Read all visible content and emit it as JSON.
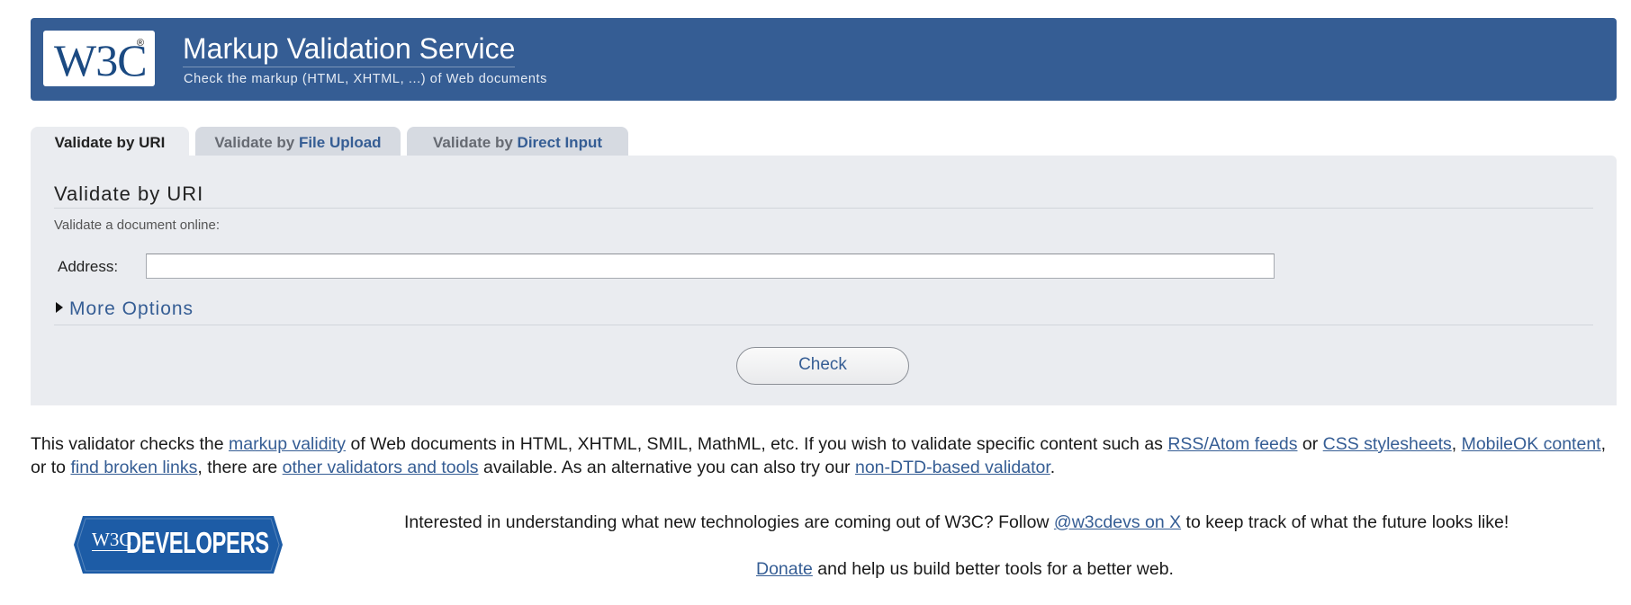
{
  "header": {
    "logo_text": "W3C",
    "logo_reg": "®",
    "title": "Markup Validation Service",
    "subtitle": "Check the markup (HTML, XHTML, ...) of Web documents"
  },
  "tabs": [
    {
      "prefix": "Validate by ",
      "highlight": "URI",
      "active": true
    },
    {
      "prefix": "Validate by ",
      "highlight": "File Upload",
      "active": false
    },
    {
      "prefix": "Validate by ",
      "highlight": "Direct Input",
      "active": false
    }
  ],
  "panel": {
    "heading": "Validate by URI",
    "description": "Validate a document online:",
    "address_label": "Address:",
    "address_value": "",
    "more_options_label": "More Options",
    "check_label": "Check"
  },
  "description_paragraph": {
    "t1": "This validator checks the ",
    "link_markup_validity": "markup validity",
    "t2": " of Web documents in HTML, XHTML, SMIL, MathML, etc. If you wish to validate specific content such as ",
    "link_rss": "RSS/Atom feeds",
    "t3": " or ",
    "link_css": "CSS stylesheets",
    "t4": ", ",
    "link_mobileok": "MobileOK content",
    "t5": ", or to ",
    "link_broken_links": "find broken links",
    "t6": ", there are ",
    "link_other_validators": "other validators and tools",
    "t7": " available. As an alternative you can also try our ",
    "link_non_dtd": "non-DTD-based validator",
    "t8": "."
  },
  "footer": {
    "developers_logo_w3c": "W3C",
    "developers_logo_text": "DEVELOPERS",
    "follow_t1": "Interested in understanding what new technologies are coming out of W3C? Follow ",
    "follow_link": "@w3cdevs on X",
    "follow_t2": " to keep track of what the future looks like!",
    "donate_link": "Donate",
    "donate_t": " and help us build better tools for a better web."
  },
  "colors": {
    "brand_blue": "#355d94",
    "panel_bg": "#eaecf0",
    "tab_inactive_bg": "#d6dae1",
    "developers_blue": "#1d5ca6"
  }
}
